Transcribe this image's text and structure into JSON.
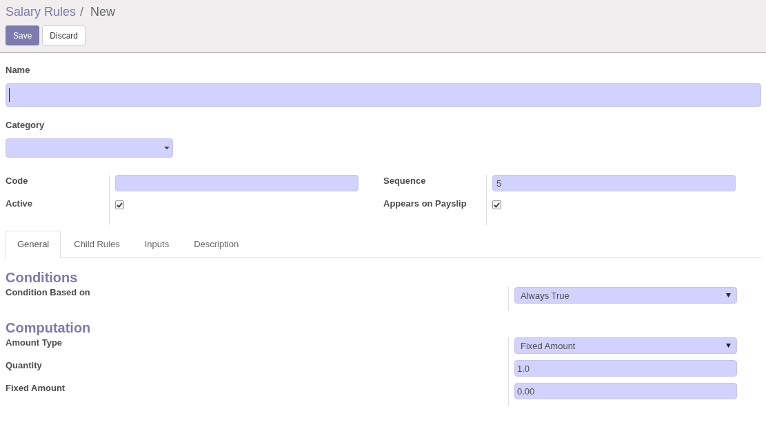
{
  "breadcrumb": {
    "parent": "Salary Rules",
    "separator": "/",
    "current": "New"
  },
  "buttons": [
    {
      "label": "Save",
      "kind": "primary"
    },
    {
      "label": "Discard",
      "kind": "secondary"
    }
  ],
  "name": {
    "label": "Name",
    "focused": true
  },
  "category": {
    "label": "Category"
  },
  "left_fields": [
    {
      "label": "Code",
      "kind": "text"
    },
    {
      "label": "Active",
      "kind": "checkbox",
      "checked": true
    }
  ],
  "right_fields": [
    {
      "label": "Sequence",
      "kind": "text",
      "value": "5"
    },
    {
      "label": "Appears on Payslip",
      "kind": "checkbox",
      "checked": true
    }
  ],
  "tabs": [
    {
      "label": "General",
      "selected": true
    },
    {
      "label": "Child Rules",
      "selected": false
    },
    {
      "label": "Inputs",
      "selected": false
    },
    {
      "label": "Description",
      "selected": false
    }
  ],
  "sections": [
    {
      "title": "Conditions",
      "rows": [
        {
          "label": "Condition Based on",
          "kind": "select",
          "value": "Always True"
        }
      ]
    },
    {
      "title": "Computation",
      "rows": [
        {
          "label": "Amount Type",
          "kind": "select",
          "value": "Fixed Amount"
        },
        {
          "label": "Quantity",
          "kind": "text",
          "value": "1.0"
        },
        {
          "label": "Fixed Amount",
          "kind": "text",
          "value": "0.00"
        }
      ]
    }
  ]
}
